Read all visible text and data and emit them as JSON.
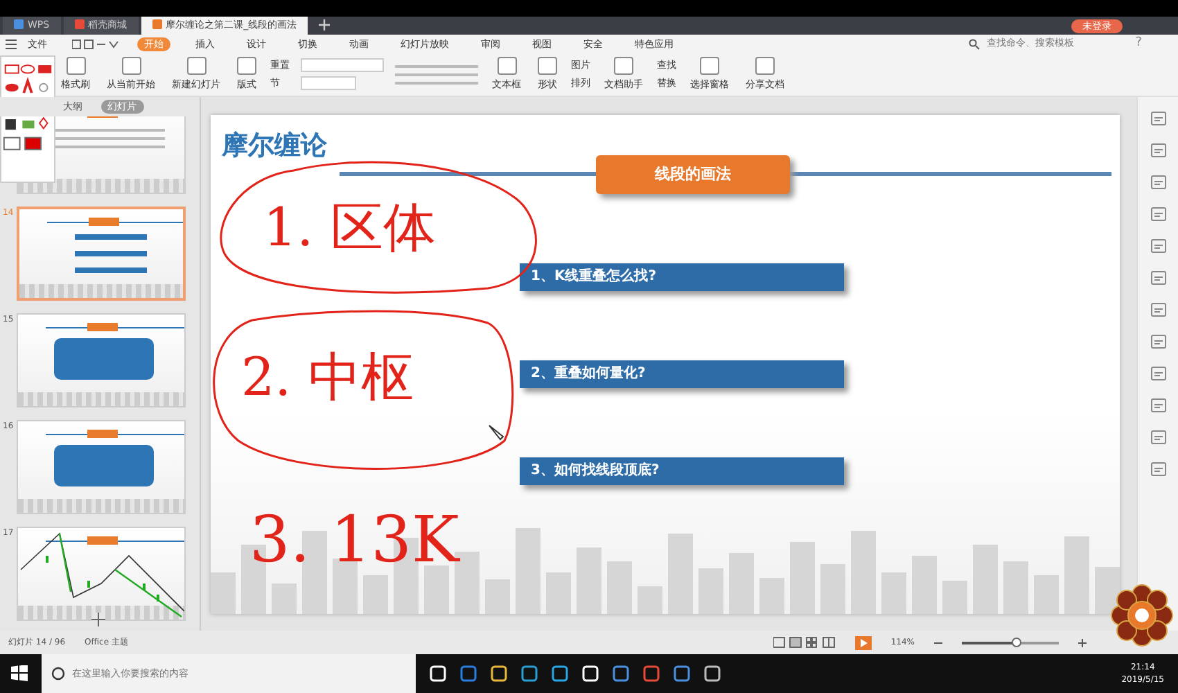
{
  "browser_tabs": [
    {
      "label": "WPS",
      "kind": "app",
      "selected": false
    },
    {
      "label": "稻壳商城",
      "kind": "store",
      "selected": false
    },
    {
      "label": "摩尔缠论之第二课_线段的画法",
      "kind": "doc",
      "selected": true
    }
  ],
  "login_button": "未登录",
  "menu": [
    {
      "label": "文件",
      "kind": "file",
      "selected": false
    },
    {
      "label": "开始",
      "kind": "tab",
      "selected": true
    },
    {
      "label": "插入",
      "kind": "tab",
      "selected": false
    },
    {
      "label": "设计",
      "kind": "tab",
      "selected": false
    },
    {
      "label": "切换",
      "kind": "tab",
      "selected": false
    },
    {
      "label": "动画",
      "kind": "tab",
      "selected": false
    },
    {
      "label": "幻灯片放映",
      "kind": "tab",
      "selected": false
    },
    {
      "label": "审阅",
      "kind": "tab",
      "selected": false
    },
    {
      "label": "视图",
      "kind": "tab",
      "selected": false
    },
    {
      "label": "安全",
      "kind": "tab",
      "selected": false
    },
    {
      "label": "特色应用",
      "kind": "tab",
      "selected": false
    }
  ],
  "command_search": {
    "placeholder": "查找命令、搜索模板"
  },
  "help_button": "?",
  "toolbar": [
    {
      "label": "格式刷",
      "kind": "large"
    },
    {
      "label": "从当前开始",
      "kind": "large"
    },
    {
      "label": "新建幻灯片",
      "kind": "large"
    },
    {
      "label": "版式",
      "kind": "large"
    },
    {
      "label": "重置",
      "kind": "small"
    },
    {
      "label": "节",
      "kind": "small"
    },
    {
      "kind": "fields"
    },
    {
      "label": "文本框",
      "kind": "large"
    },
    {
      "label": "形状",
      "kind": "large"
    },
    {
      "label": "图片",
      "kind": "small"
    },
    {
      "label": "排列",
      "kind": "small"
    },
    {
      "label": "文档助手",
      "kind": "large"
    },
    {
      "label": "查找",
      "kind": "small"
    },
    {
      "label": "替换",
      "kind": "small"
    },
    {
      "label": "选择窗格",
      "kind": "large"
    },
    {
      "label": "分享文档",
      "kind": "large"
    }
  ],
  "panel_tabs": [
    {
      "label": "大纲",
      "selected": false
    },
    {
      "label": "幻灯片",
      "selected": true
    }
  ],
  "thumbnails": [
    {
      "kind": "text",
      "selected": false
    },
    {
      "number": "14",
      "kind": "list",
      "selected": true
    },
    {
      "number": "15",
      "kind": "box",
      "selected": false
    },
    {
      "number": "16",
      "kind": "box",
      "selected": false
    },
    {
      "number": "17",
      "kind": "chart",
      "selected": false
    }
  ],
  "slide": {
    "title": "摩尔缠论",
    "banner": "线段的画法",
    "items": [
      "1、K线重叠怎么找?",
      "2、重叠如何量化?",
      "3、如何找线段顶底?"
    ]
  },
  "ink_notes": [
    "1. 区体",
    "2. 中枢",
    "3. 13K"
  ],
  "status_bar": {
    "slide_counter": "幻灯片 14 / 96",
    "theme": "Office 主题",
    "zoom": "114%",
    "zoom_slider": {
      "level": 0.55
    }
  },
  "taskbar": {
    "search_placeholder": "在这里输入你要搜索的内容",
    "time": "21:14",
    "date": "2019/5/15"
  }
}
